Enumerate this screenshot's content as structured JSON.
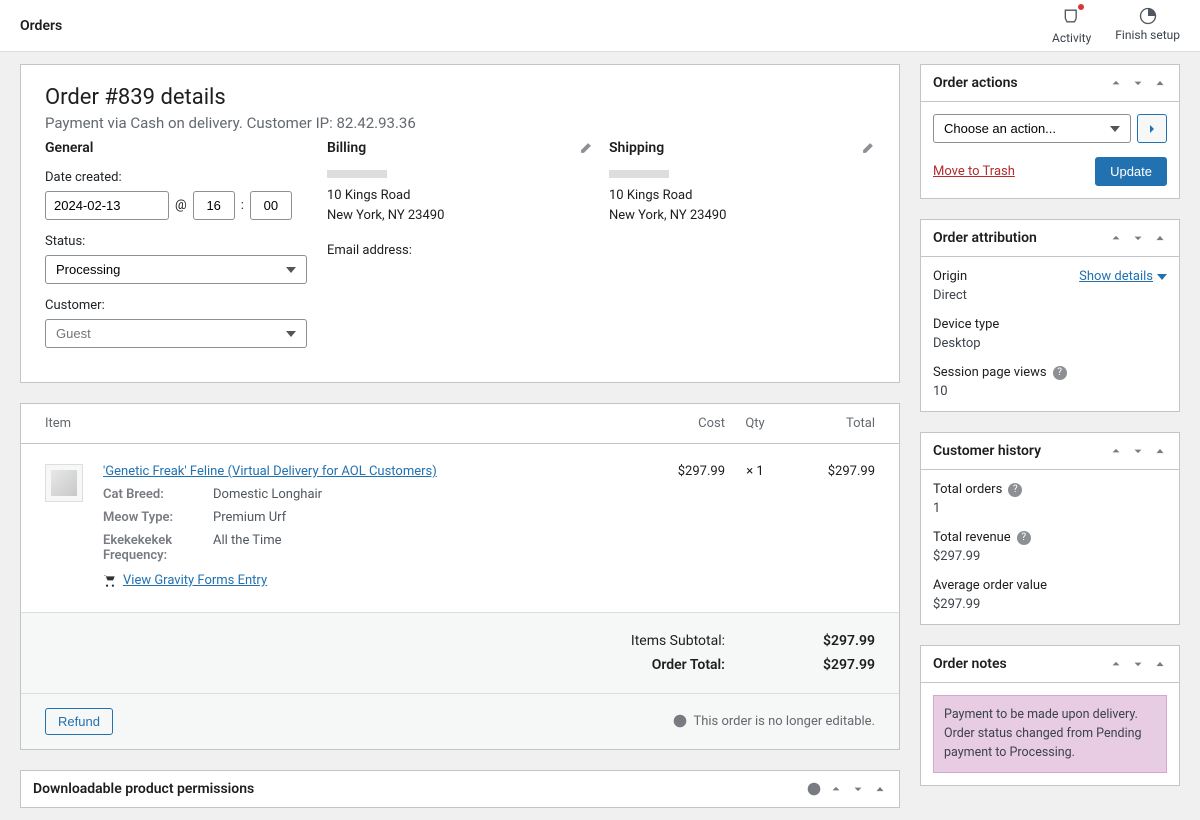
{
  "topbar": {
    "title": "Orders",
    "activity": "Activity",
    "finish_setup": "Finish setup"
  },
  "order": {
    "title": "Order #839 details",
    "subtitle": "Payment via Cash on delivery. Customer IP: 82.42.93.36",
    "general_h": "General",
    "billing_h": "Billing",
    "shipping_h": "Shipping",
    "date_created_label": "Date created:",
    "date": "2024-02-13",
    "at": "@",
    "hour": "16",
    "colon": ":",
    "minute": "00",
    "status_label": "Status:",
    "status_value": "Processing",
    "customer_label": "Customer:",
    "customer_value": "Guest",
    "billing_addr1": "10 Kings Road",
    "billing_addr2": "New York, NY 23490",
    "shipping_addr1": "10 Kings Road",
    "shipping_addr2": "New York, NY 23490",
    "email_label": "Email address:"
  },
  "items": {
    "h_item": "Item",
    "h_cost": "Cost",
    "h_qty": "Qty",
    "h_total": "Total",
    "line": {
      "name": "'Genetic Freak' Feline (Virtual Delivery for AOL Customers)",
      "meta1_label": "Cat Breed:",
      "meta1_val": "Domestic Longhair",
      "meta2_label": "Meow Type:",
      "meta2_val": "Premium Urf",
      "meta3_label": "Ekekekekek Frequency:",
      "meta3_val": "All the Time",
      "gf_link": "View Gravity Forms Entry",
      "cost": "$297.99",
      "qty_pre": "× ",
      "qty": "1",
      "total": "$297.99"
    },
    "subtotal_label": "Items Subtotal:",
    "subtotal_val": "$297.99",
    "ordertotal_label": "Order Total:",
    "ordertotal_val": "$297.99",
    "refund": "Refund",
    "not_editable": "This order is no longer editable."
  },
  "downloadable": {
    "title": "Downloadable product permissions"
  },
  "actions": {
    "title": "Order actions",
    "choose": "Choose an action...",
    "trash": "Move to Trash",
    "update": "Update"
  },
  "attribution": {
    "title": "Order attribution",
    "origin_label": "Origin",
    "origin_val": "Direct",
    "show_details": "Show details",
    "device_label": "Device type",
    "device_val": "Desktop",
    "views_label": "Session page views",
    "views_val": "10"
  },
  "history": {
    "title": "Customer history",
    "orders_label": "Total orders",
    "orders_val": "1",
    "revenue_label": "Total revenue",
    "revenue_val": "$297.99",
    "aov_label": "Average order value",
    "aov_val": "$297.99"
  },
  "notes": {
    "title": "Order notes",
    "note1": "Payment to be made upon delivery. Order status changed from Pending payment to Processing."
  }
}
